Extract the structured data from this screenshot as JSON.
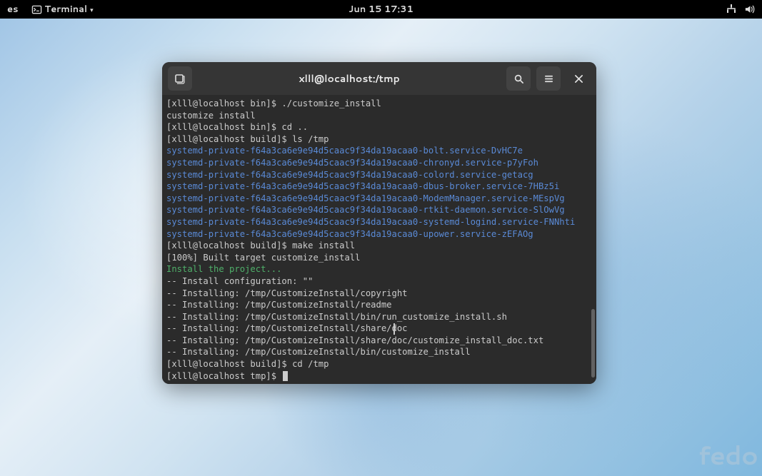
{
  "topbar": {
    "left_text": "es",
    "app_name": "Terminal",
    "datetime": "Jun 15  17:31"
  },
  "terminal": {
    "title": "xlll@localhost:/tmp",
    "lines": [
      {
        "cls": "",
        "text": "[xlll@localhost bin]$ ./customize_install"
      },
      {
        "cls": "",
        "text": "customize install"
      },
      {
        "cls": "",
        "text": "[xlll@localhost bin]$ cd .."
      },
      {
        "cls": "",
        "text": "[xlll@localhost build]$ ls /tmp"
      },
      {
        "cls": "ls-blue",
        "text": "systemd-private-f64a3ca6e9e94d5caac9f34da19acaa0-bolt.service-DvHC7e"
      },
      {
        "cls": "ls-blue",
        "text": "systemd-private-f64a3ca6e9e94d5caac9f34da19acaa0-chronyd.service-p7yFoh"
      },
      {
        "cls": "ls-blue",
        "text": "systemd-private-f64a3ca6e9e94d5caac9f34da19acaa0-colord.service-getacg"
      },
      {
        "cls": "ls-blue",
        "text": "systemd-private-f64a3ca6e9e94d5caac9f34da19acaa0-dbus-broker.service-7HBz5i"
      },
      {
        "cls": "ls-blue",
        "text": "systemd-private-f64a3ca6e9e94d5caac9f34da19acaa0-ModemManager.service-MEspVg"
      },
      {
        "cls": "ls-blue",
        "text": "systemd-private-f64a3ca6e9e94d5caac9f34da19acaa0-rtkit-daemon.service-SlOwVg"
      },
      {
        "cls": "ls-blue",
        "text": "systemd-private-f64a3ca6e9e94d5caac9f34da19acaa0-systemd-logind.service-FNNhti"
      },
      {
        "cls": "ls-blue",
        "text": "systemd-private-f64a3ca6e9e94d5caac9f34da19acaa0-upower.service-zEFAOg"
      },
      {
        "cls": "",
        "text": "[xlll@localhost build]$ make install"
      },
      {
        "cls": "",
        "text": "[100%] Built target customize_install"
      },
      {
        "cls": "cmake-green",
        "text": "Install the project..."
      },
      {
        "cls": "",
        "text": "-- Install configuration: \"\""
      },
      {
        "cls": "",
        "text": "-- Installing: /tmp/CustomizeInstall/copyright"
      },
      {
        "cls": "",
        "text": "-- Installing: /tmp/CustomizeInstall/readme"
      },
      {
        "cls": "",
        "text": "-- Installing: /tmp/CustomizeInstall/bin/run_customize_install.sh"
      },
      {
        "cls": "",
        "text": "-- Installing: /tmp/CustomizeInstall/share/doc"
      },
      {
        "cls": "",
        "text": "-- Installing: /tmp/CustomizeInstall/share/doc/customize_install_doc.txt"
      },
      {
        "cls": "",
        "text": "-- Installing: /tmp/CustomizeInstall/bin/customize_install"
      },
      {
        "cls": "",
        "text": "[xlll@localhost build]$ cd /tmp"
      },
      {
        "cls": "",
        "text": "[xlll@localhost tmp]$ ",
        "cursor": true
      }
    ]
  },
  "brand": "fedo"
}
